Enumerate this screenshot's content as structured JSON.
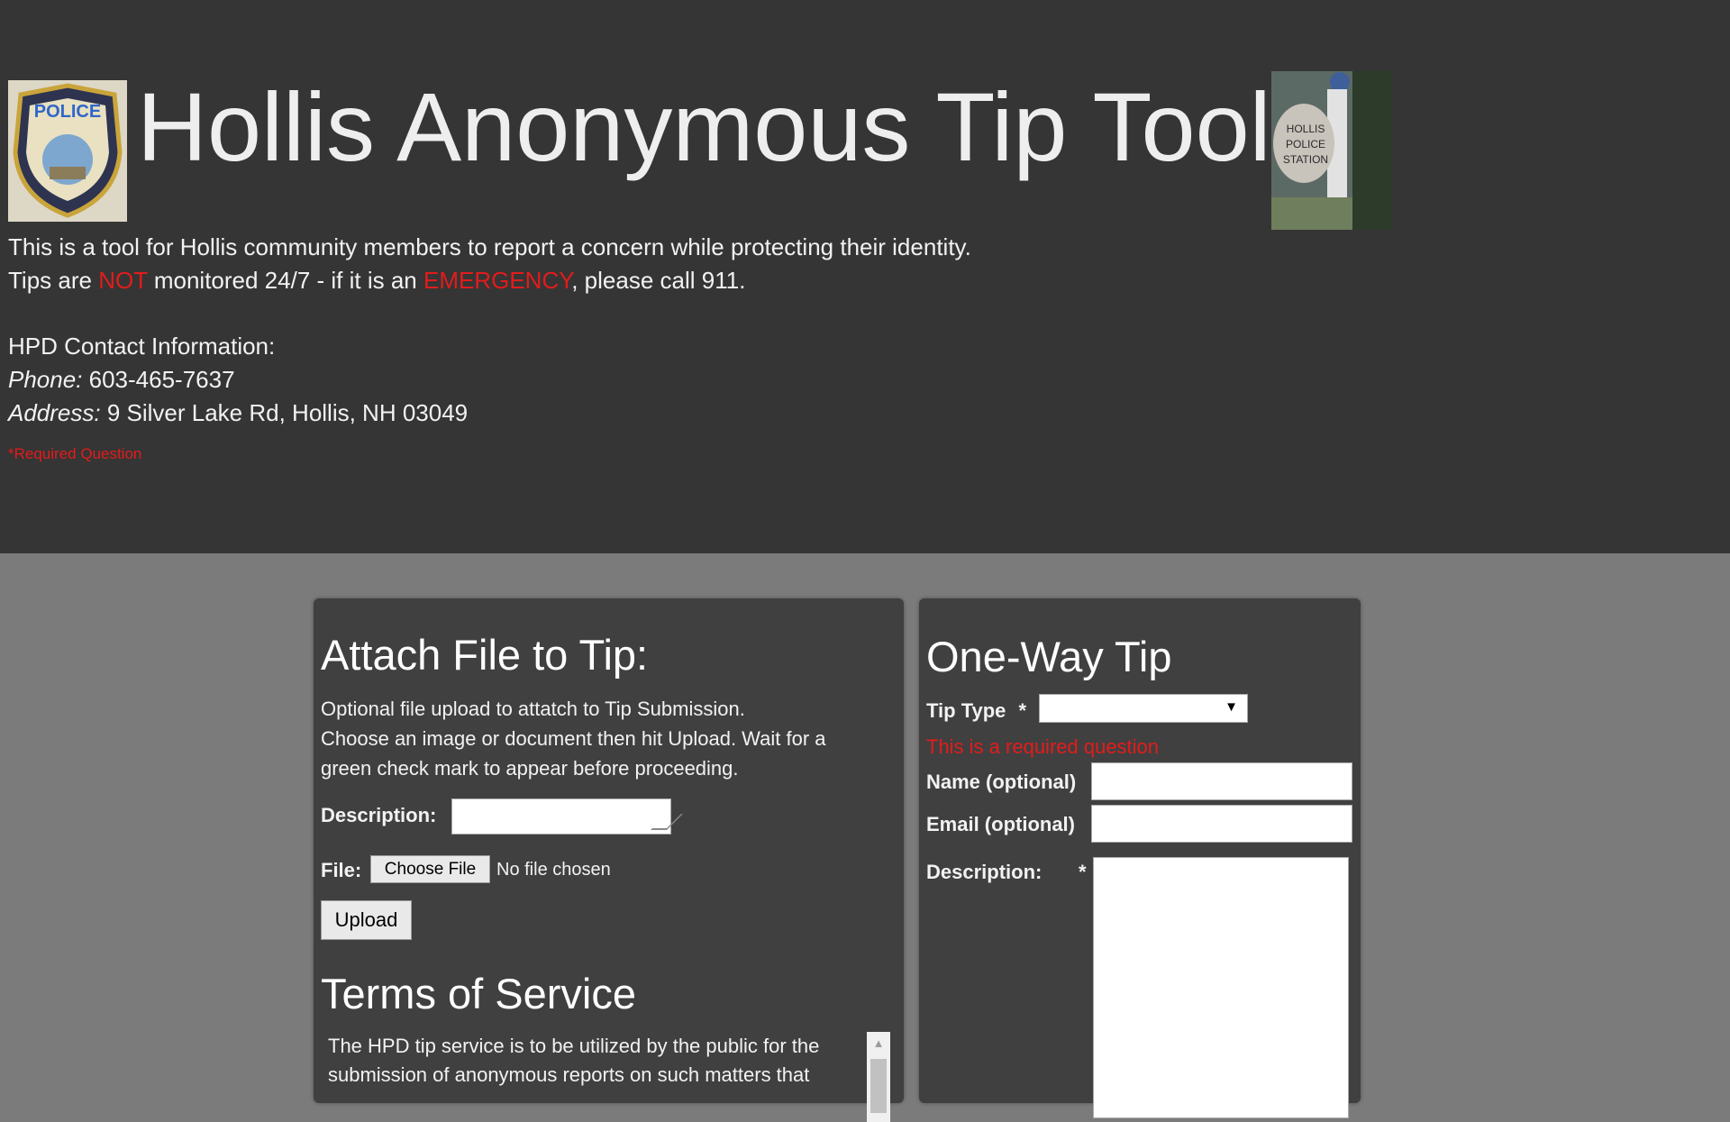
{
  "header": {
    "title": "Hollis Anonymous Tip Tool",
    "intro_line1": "This is a tool for Hollis community members to report a concern while protecting their identity.",
    "intro_line2_a": "Tips are ",
    "intro_line2_not": "NOT",
    "intro_line2_b": " monitored 24/7 - if it is an ",
    "intro_line2_emergency": "EMERGENCY",
    "intro_line2_c": ", please call 911.",
    "contact_heading": "HPD Contact Information:",
    "phone_label": "Phone:",
    "phone_value": " 603-465-7637",
    "address_label": "Address:",
    "address_value": " 9 Silver Lake Rd, Hollis, NH 03049",
    "required_note": "*Required Question",
    "logo_left_text": "POLICE",
    "sign_text_1": "HOLLIS",
    "sign_text_2": "POLICE",
    "sign_text_3": "STATION"
  },
  "attach": {
    "title": "Attach File to Tip:",
    "help_line1": "Optional file upload to attatch to Tip Submission.",
    "help_line2": "Choose an image or document then hit Upload. Wait for a green check mark to appear before proceeding.",
    "description_label": "Description:",
    "file_label": "File:",
    "choose_file_label": "Choose File",
    "no_file_text": "No file chosen",
    "upload_label": "Upload",
    "tos_title": "Terms of Service",
    "tos_text": "The HPD tip service is to be utilized by the public for the submission of anonymous reports on such matters that"
  },
  "tip": {
    "title": "One-Way Tip",
    "tip_type_label": "Tip Type",
    "required_star": "*",
    "tip_type_value": "",
    "required_error": "This is a required question",
    "name_label": "Name (optional)",
    "email_label": "Email (optional)",
    "description_label": "Description:",
    "description_star": "*"
  }
}
